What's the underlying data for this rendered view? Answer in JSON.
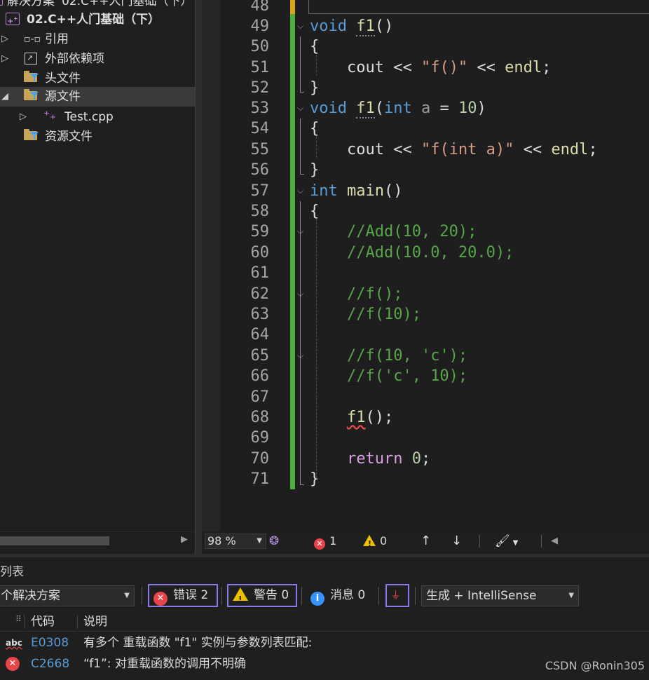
{
  "solution_explorer": {
    "solution_title": "解决方案 '02.C++人门基础（下）'",
    "project": "02.C++人门基础（下）",
    "project_icon": "cpp-project-icon",
    "items": [
      {
        "label": "引用",
        "icon": "references-icon"
      },
      {
        "label": "外部依赖项",
        "icon": "external-deps-icon"
      },
      {
        "label": "头文件",
        "icon": "filter-folder-icon"
      },
      {
        "label": "源文件",
        "icon": "filter-folder-icon"
      },
      {
        "label": "Test.cpp",
        "icon": "cpp-file-icon"
      },
      {
        "label": "资源文件",
        "icon": "filter-folder-icon"
      }
    ]
  },
  "editor": {
    "line_numbers": [
      "48",
      "49",
      "50",
      "51",
      "52",
      "53",
      "54",
      "55",
      "56",
      "57",
      "58",
      "59",
      "60",
      "61",
      "62",
      "63",
      "64",
      "65",
      "66",
      "67",
      "68",
      "69",
      "70",
      "71"
    ]
  },
  "status_bar": {
    "zoom": "98 %",
    "errors": "1",
    "warnings": "0"
  },
  "error_list": {
    "title": "列表",
    "scope": "个解决方案",
    "errors_btn": "错误 2",
    "warnings_btn": "警告 0",
    "messages_btn": "消息 0",
    "build_filter": "生成 + IntelliSense",
    "col_code": "代码",
    "col_desc": "说明",
    "rows": [
      {
        "code": "E0308",
        "desc": "有多个 重载函数 \"f1\" 实例与参数列表匹配:",
        "icon": "intellisense-error-icon"
      },
      {
        "code": "C2668",
        "desc": "“f1”: 对重载函数的调用不明确",
        "icon": "error-icon"
      }
    ]
  },
  "watermark": "CSDN @Ronin305",
  "colors": {
    "keyword": "#569cd6",
    "control_keyword": "#d8a0df",
    "string": "#d69d85",
    "number": "#b5cea8",
    "comment": "#57a64a",
    "change_bar": "#4caf3f",
    "error": "#e8454a",
    "warning": "#f0c000"
  }
}
